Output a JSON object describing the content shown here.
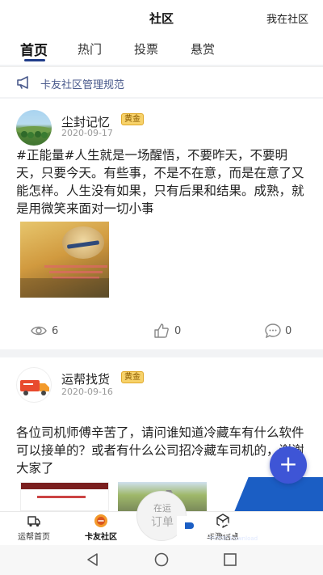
{
  "header": {
    "title": "社区",
    "right_link": "我在社区"
  },
  "tabs": [
    {
      "label": "首页",
      "active": true
    },
    {
      "label": "热门",
      "active": false
    },
    {
      "label": "投票",
      "active": false
    },
    {
      "label": "悬赏",
      "active": false
    }
  ],
  "notice": {
    "icon": "megaphone-icon",
    "text": "卡友社区管理规范"
  },
  "posts": [
    {
      "user": "尘封记忆",
      "badge": "黄金",
      "date": "2020-09-17",
      "text": "#正能量#人生就是一场醒悟，不要昨天，不要明天，只要今天。有些事，不是不在意，而是在意了又能怎样。人生没有如果，只有后果和结果。成熟，就是用微笑来面对一切小事",
      "views": "6",
      "likes": "0",
      "comments": "0"
    },
    {
      "user": "运帮找货",
      "badge": "黄金",
      "date": "2020-09-16",
      "text": "各位司机师傅辛苦了，请问谁知道冷藏车有什么软件可以接单的？或者有什么公司招冷藏车司机的，谢谢大家了"
    }
  ],
  "fab": {
    "label": "+"
  },
  "bottom_nav": [
    {
      "label": "运帮首页",
      "icon": "truck-icon",
      "active": false
    },
    {
      "label": "卡友社区",
      "icon": "community-icon",
      "active": true
    },
    {
      "label": "车源信息",
      "icon": "box-icon",
      "active": false
    }
  ],
  "center_button": {
    "line1": "在运",
    "line2": "订单"
  },
  "watermark": {
    "text": "PCPOP下载",
    "sub": "PCPOP Download"
  },
  "colors": {
    "accent": "#1f3c8a",
    "fab": "#3e55d6",
    "badge": "#f7d26a",
    "watermark": "#1b5ec4"
  }
}
